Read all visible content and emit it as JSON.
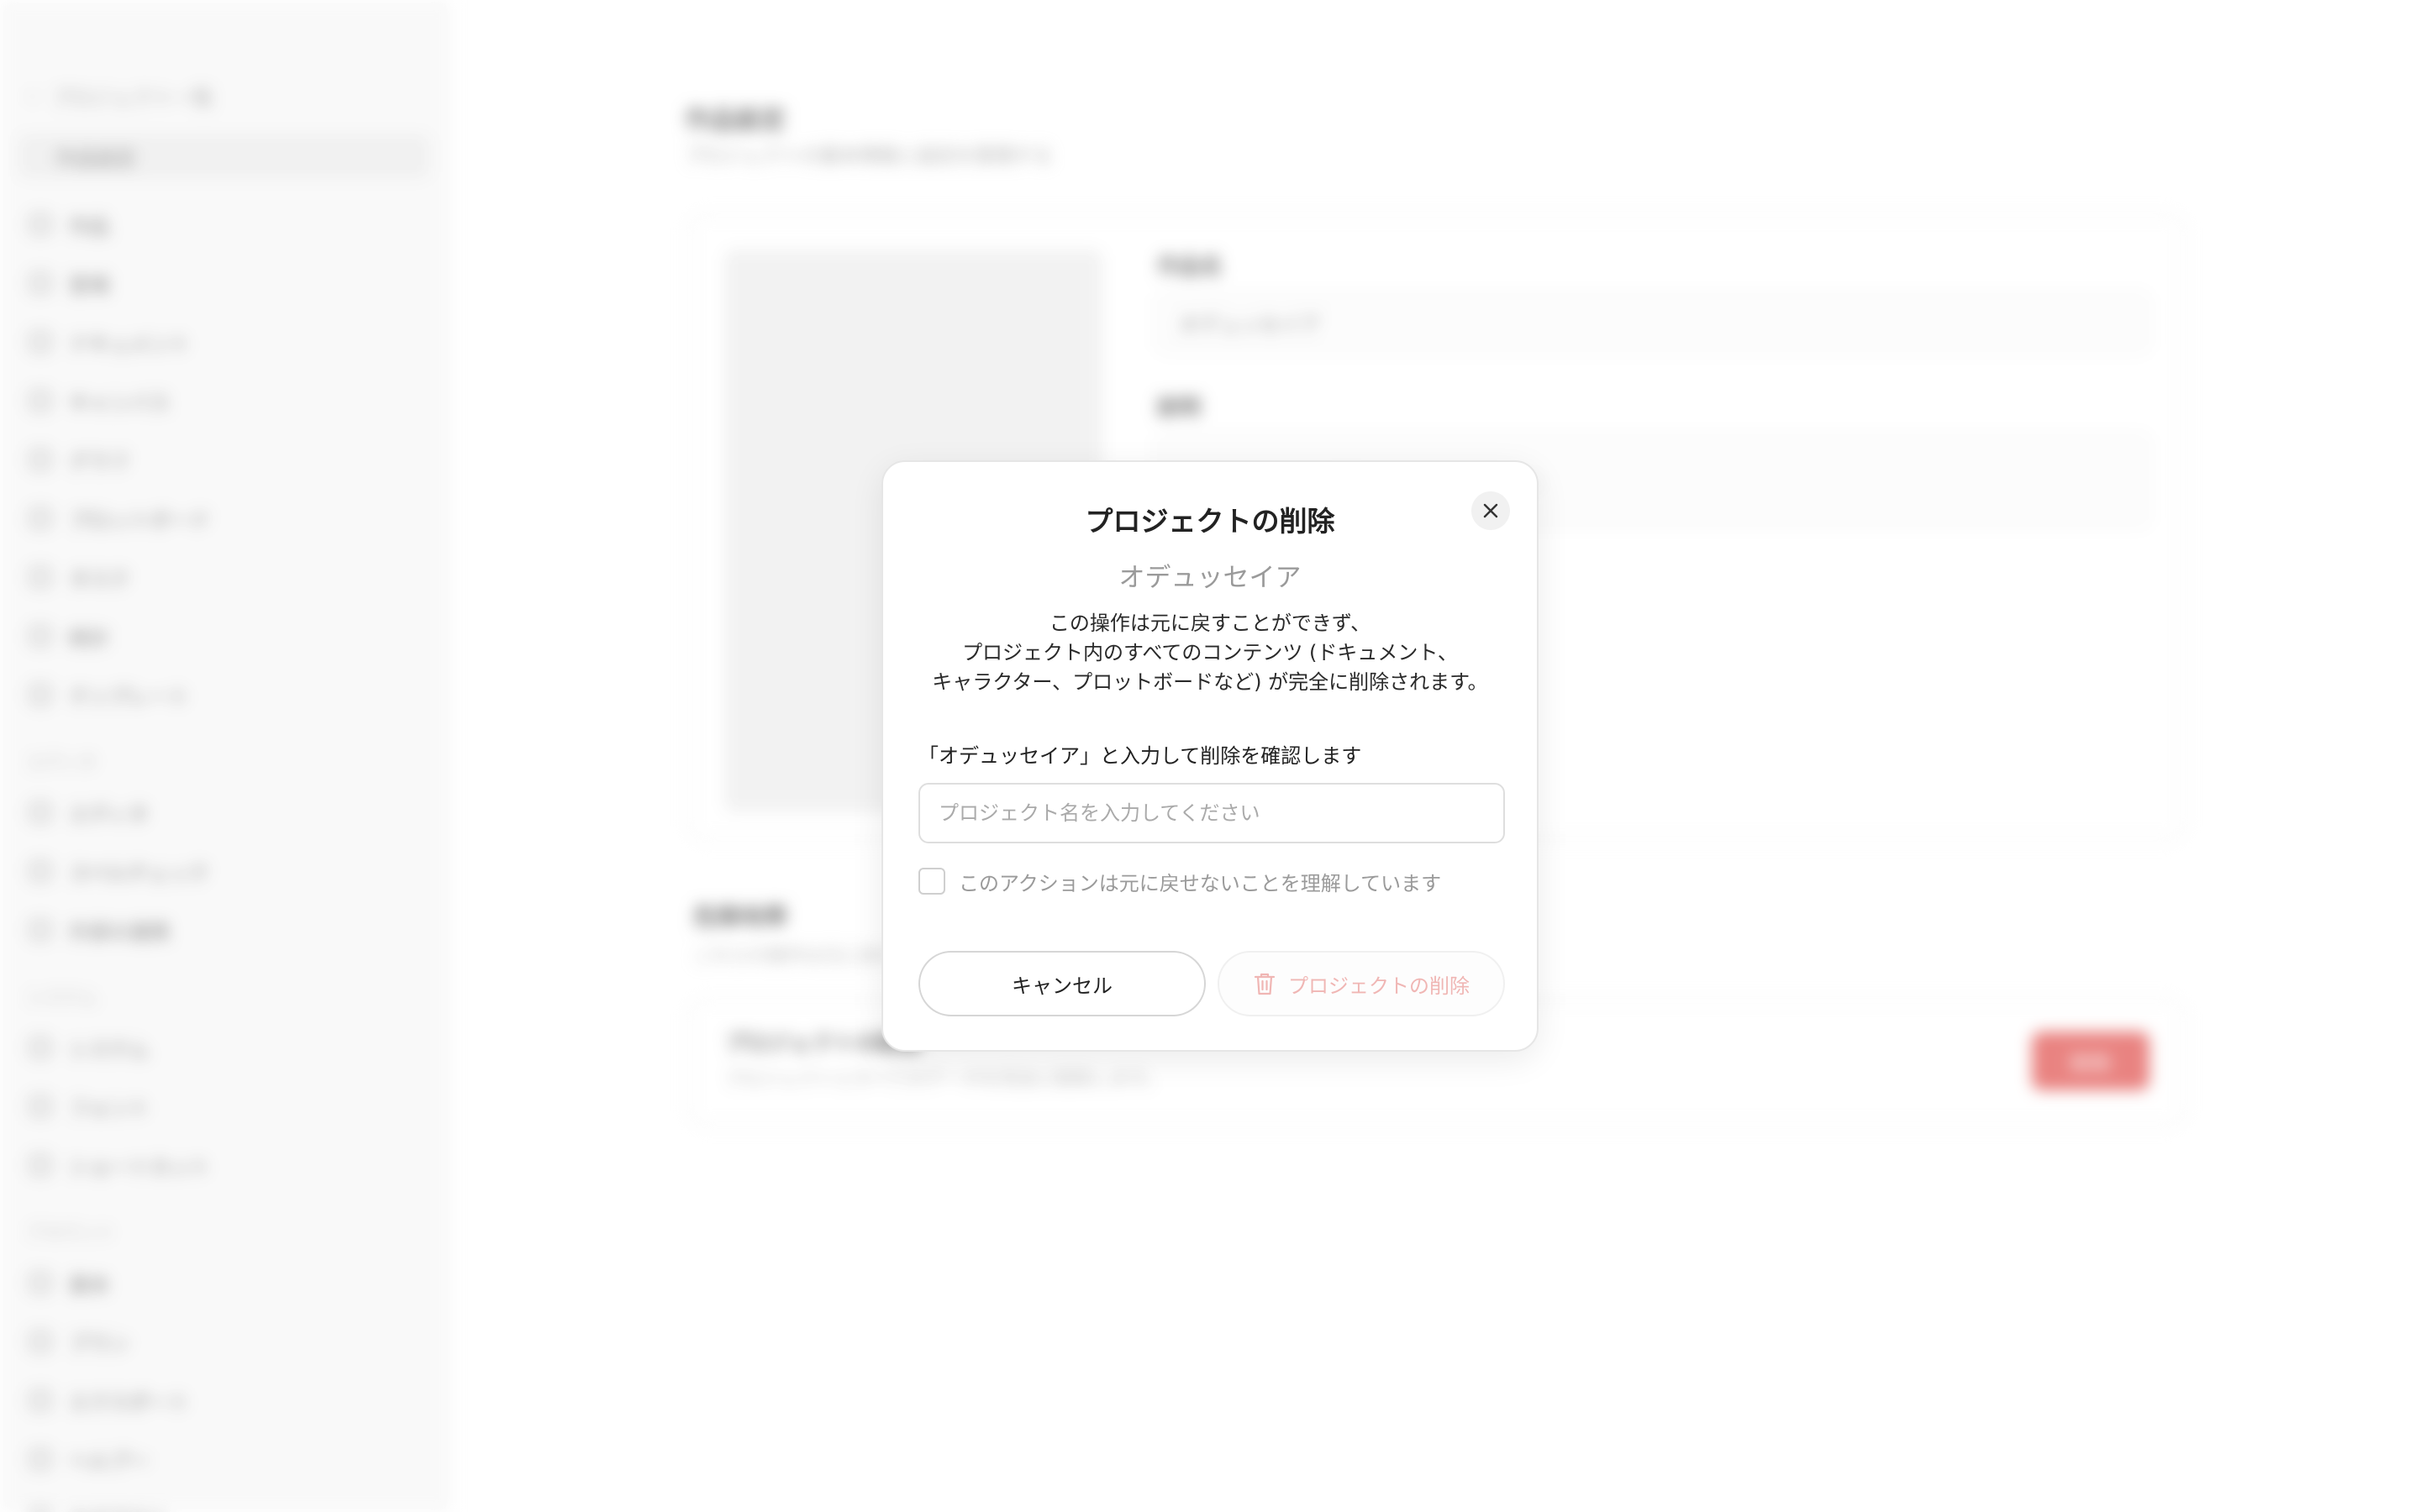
{
  "background": {
    "sidebar": {
      "back_label": "プロジェクト一覧",
      "active_label": "作品設定",
      "items": [
        {
          "label": "作品",
          "icon": "book-icon"
        },
        {
          "label": "登場",
          "icon": "person-icon"
        },
        {
          "label": "ドキュメント",
          "icon": "document-icon"
        },
        {
          "label": "キャンバス",
          "icon": "canvas-icon"
        },
        {
          "label": "グラフ",
          "icon": "graph-icon"
        },
        {
          "label": "プロットボード",
          "icon": "board-icon"
        },
        {
          "label": "タスク",
          "icon": "task-icon"
        },
        {
          "label": "統計",
          "icon": "stats-icon"
        },
        {
          "label": "テンプレート",
          "icon": "template-icon"
        }
      ],
      "section_editor": "エディタ",
      "editor_items": [
        {
          "label": "エディタ",
          "icon": "editor-icon"
        },
        {
          "label": "スペルチェック",
          "icon": "spellcheck-icon"
        },
        {
          "label": "外部の連携",
          "icon": "link-icon"
        }
      ],
      "section_system": "システム",
      "system_items": [
        {
          "label": "システム",
          "icon": "system-icon"
        },
        {
          "label": "フォント",
          "icon": "font-icon"
        },
        {
          "label": "ショートカット",
          "icon": "keyboard-icon"
        }
      ],
      "section_account": "アカウント",
      "account_items": [
        {
          "label": "基本",
          "icon": "gear-icon"
        },
        {
          "label": "プラン",
          "icon": "plan-icon"
        },
        {
          "label": "エクスポート",
          "icon": "export-icon"
        },
        {
          "label": "ヘルプー",
          "icon": "help-icon"
        },
        {
          "label": "ログアウト",
          "icon": "logout-icon"
        }
      ]
    },
    "main": {
      "title": "作品設定",
      "subtitle": "プロジェクトの基本情報と設定を管理する",
      "name_label": "作品名",
      "name_value": "オデュッセイア",
      "desc_label": "説明",
      "desc_value": "プロジェクトの説明を入力してください",
      "danger_title": "危険地帯",
      "danger_subtitle": "これらの操作は元に戻せません",
      "danger_item_title": "プロジェクトの削除",
      "danger_item_desc": "プロジェクトとすべてのデータを完全に削除します。",
      "danger_button": "削除"
    }
  },
  "modal": {
    "title": "プロジェクトの削除",
    "project_name": "オデュッセイア",
    "warning_line1": "この操作は元に戻すことができず、",
    "warning_line2": "プロジェクト内のすべてのコンテンツ (ドキュメント、",
    "warning_line3": "キャラクター、プロットボードなど) が完全に削除されます。",
    "confirm_label": "「オデュッセイア」と入力して削除を確認します",
    "input_value": "",
    "input_placeholder": "プロジェクト名を入力してください",
    "checkbox_label": "このアクションは元に戻せないことを理解しています",
    "checkbox_checked": false,
    "cancel_label": "キャンセル",
    "delete_label": "プロジェクトの削除",
    "delete_enabled": false,
    "close_icon": "close-icon",
    "delete_icon": "trash-icon"
  },
  "colors": {
    "danger": "#e25a57",
    "danger_disabled": "#f0b6b4",
    "muted_text": "#9a9a9a"
  }
}
